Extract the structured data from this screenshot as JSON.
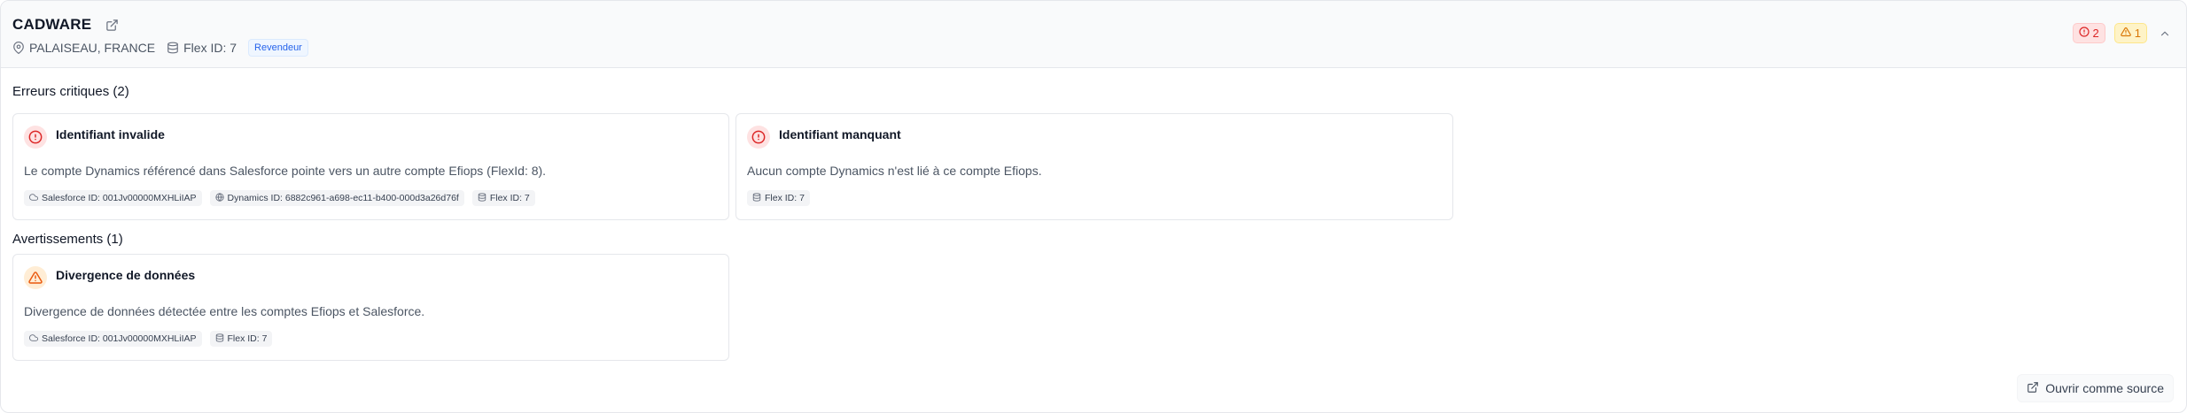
{
  "account": {
    "name": "CADWARE",
    "location": "PALAISEAU, FRANCE",
    "flex_id": "Flex ID: 7",
    "type_badge": "Revendeur"
  },
  "summary": {
    "error_count": "2",
    "warning_count": "1"
  },
  "critical_section": {
    "title": "Erreurs critiques (2)",
    "cards": [
      {
        "title": "Identifiant invalide",
        "description": "Le compte Dynamics référencé dans Salesforce pointe vers un autre compte Efiops (FlexId: 8).",
        "tags": [
          "Salesforce ID: 001Jv00000MXHLiIAP",
          "Dynamics ID: 6882c961-a698-ec11-b400-000d3a26d76f",
          "Flex ID: 7"
        ]
      },
      {
        "title": "Identifiant manquant",
        "description": "Aucun compte Dynamics n'est lié à ce compte Efiops.",
        "tags": [
          "Flex ID: 7"
        ]
      }
    ]
  },
  "warning_section": {
    "title": "Avertissements (1)",
    "cards": [
      {
        "title": "Divergence de données",
        "description": "Divergence de données détectée entre les comptes Efiops et Salesforce.",
        "tags": [
          "Salesforce ID: 001Jv00000MXHLiIAP",
          "Flex ID: 7"
        ]
      }
    ]
  },
  "actions": {
    "open_as_source": "Ouvrir comme source"
  },
  "colors": {
    "error": "#dc2626",
    "warning": "#ea580c",
    "badge_blue": "#2563eb"
  },
  "icons": {
    "external_link": "external-link-icon",
    "location": "map-pin-icon",
    "database": "database-icon",
    "error": "alert-circle-icon",
    "warning": "alert-triangle-icon",
    "chevron": "chevron-up-icon",
    "cloud": "cloud-icon",
    "globe": "globe-icon"
  }
}
